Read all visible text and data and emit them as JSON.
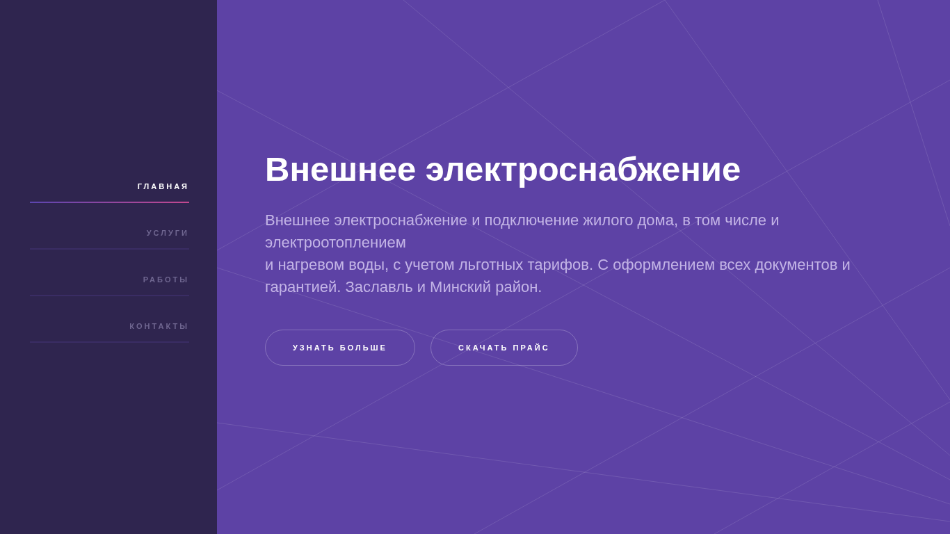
{
  "nav": [
    {
      "label": "ГЛАВНАЯ",
      "selected": true
    },
    {
      "label": "УСЛУГИ",
      "selected": false
    },
    {
      "label": "РАБОТЫ",
      "selected": false
    },
    {
      "label": "КОНТАКТЫ",
      "selected": false
    }
  ],
  "hero": {
    "title": "Внешнее электроснабжение",
    "description": [
      "Внешнее электроснабжение и подключение жилого дома, в том числе и электроотоплением",
      "и нагревом воды, с учетом льготных тарифов. С оформлением всех документов и гарантией. Заславль и Минский район."
    ],
    "buttons": [
      "УЗНАТЬ БОЛЬШЕ",
      "СКАЧАТЬ ПРАЙС"
    ]
  }
}
